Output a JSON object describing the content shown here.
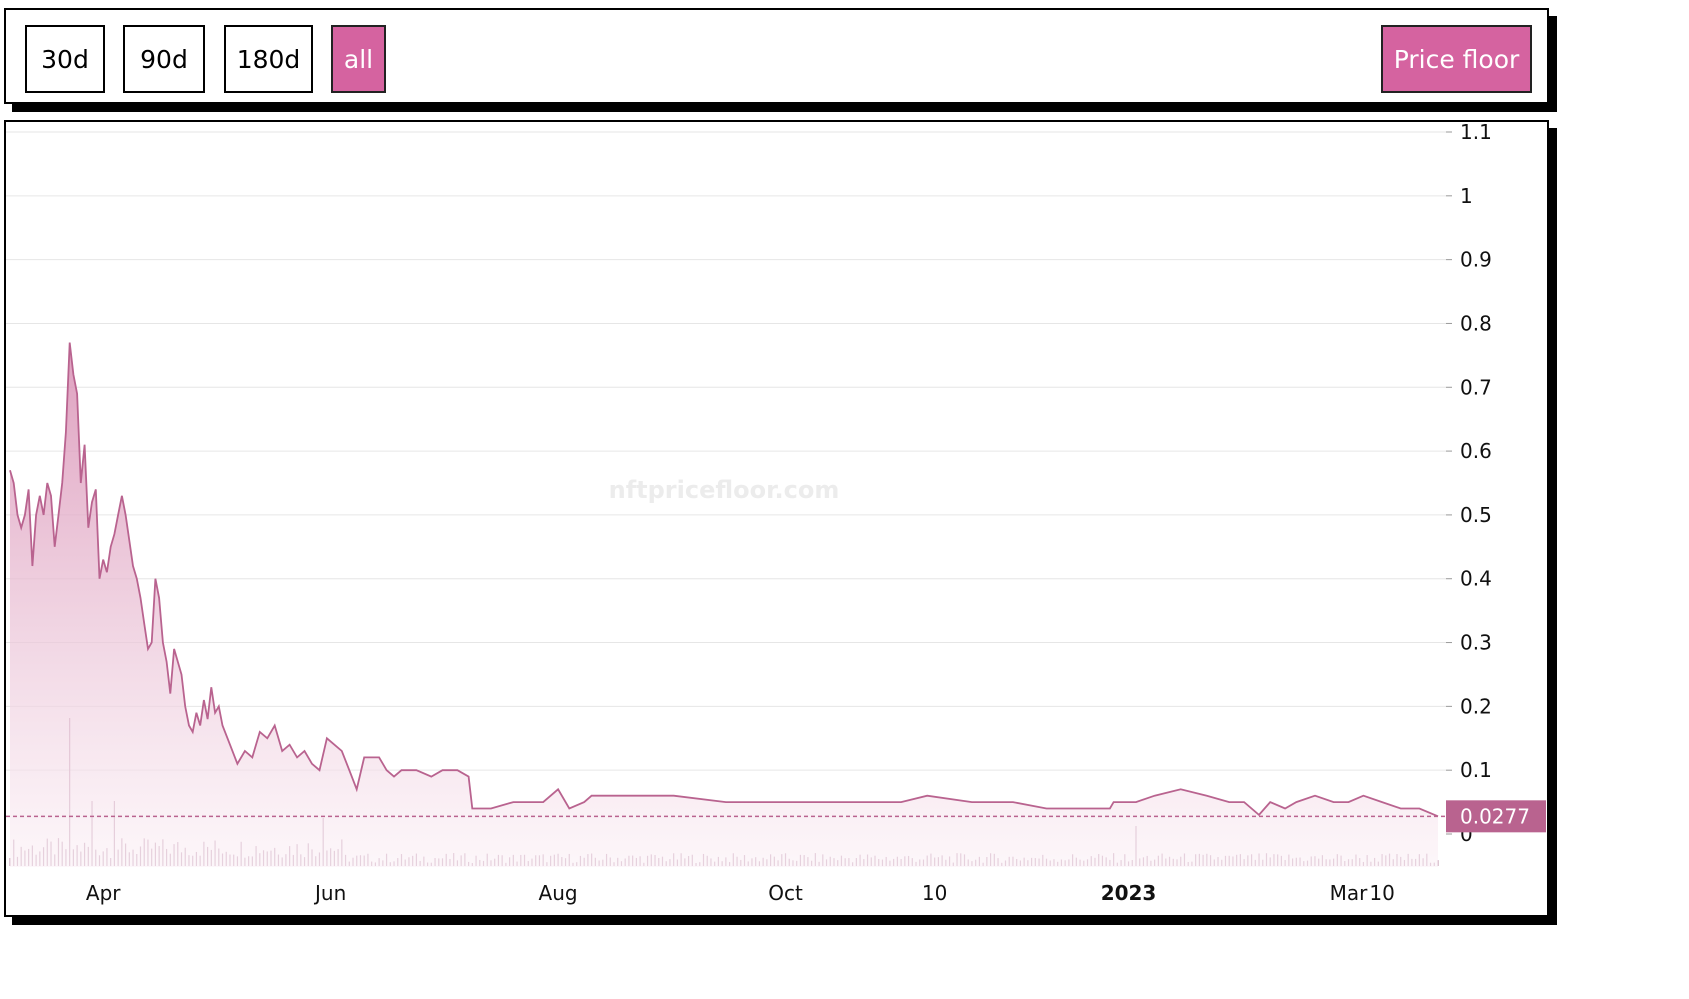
{
  "toolbar": {
    "range_buttons": [
      {
        "label": "30d",
        "active": false
      },
      {
        "label": "90d",
        "active": false
      },
      {
        "label": "180d",
        "active": false
      },
      {
        "label": "all",
        "active": true
      }
    ],
    "metric_button": {
      "label": "Price floor",
      "active": true
    }
  },
  "colors": {
    "accent": "#d563a0",
    "line": "#b9638f",
    "fill_top": "#d88eb3",
    "fill_bottom": "#fbf1f6",
    "volume": "#c7a2b8",
    "grid": "#e6e6e6"
  },
  "chart_data": {
    "type": "area",
    "title": "",
    "xlabel": "",
    "ylabel": "",
    "watermark": "nftpricefloor.com",
    "ylim": [
      0,
      1.1
    ],
    "yticks": [
      "0",
      "0.1",
      "0.2",
      "0.3",
      "0.4",
      "0.5",
      "0.6",
      "0.7",
      "0.8",
      "0.9",
      "1",
      "1.1"
    ],
    "xticks": [
      {
        "label": "Apr",
        "date": "2022-04-01",
        "bold": false
      },
      {
        "label": "Jun",
        "date": "2022-06-01",
        "bold": false
      },
      {
        "label": "Aug",
        "date": "2022-08-01",
        "bold": false
      },
      {
        "label": "Oct",
        "date": "2022-10-01",
        "bold": false
      },
      {
        "label": "10",
        "date": "2022-11-10",
        "bold": false
      },
      {
        "label": "2023",
        "date": "2023-01-01",
        "bold": true
      },
      {
        "label": "Mar",
        "date": "2023-03-01",
        "bold": false
      },
      {
        "label": "10",
        "date": "2023-03-10",
        "bold": false
      }
    ],
    "grid": true,
    "last_value": "0.0277",
    "series": [
      {
        "values": [
          [
            "2022-03-07",
            0.57
          ],
          [
            "2022-03-08",
            0.55
          ],
          [
            "2022-03-09",
            0.5
          ],
          [
            "2022-03-10",
            0.48
          ],
          [
            "2022-03-11",
            0.5
          ],
          [
            "2022-03-12",
            0.54
          ],
          [
            "2022-03-13",
            0.42
          ],
          [
            "2022-03-14",
            0.5
          ],
          [
            "2022-03-15",
            0.53
          ],
          [
            "2022-03-16",
            0.5
          ],
          [
            "2022-03-17",
            0.55
          ],
          [
            "2022-03-18",
            0.53
          ],
          [
            "2022-03-19",
            0.45
          ],
          [
            "2022-03-20",
            0.5
          ],
          [
            "2022-03-21",
            0.55
          ],
          [
            "2022-03-22",
            0.63
          ],
          [
            "2022-03-23",
            0.77
          ],
          [
            "2022-03-24",
            0.72
          ],
          [
            "2022-03-25",
            0.69
          ],
          [
            "2022-03-26",
            0.55
          ],
          [
            "2022-03-27",
            0.61
          ],
          [
            "2022-03-28",
            0.48
          ],
          [
            "2022-03-29",
            0.52
          ],
          [
            "2022-03-30",
            0.54
          ],
          [
            "2022-03-31",
            0.4
          ],
          [
            "2022-04-01",
            0.43
          ],
          [
            "2022-04-02",
            0.41
          ],
          [
            "2022-04-03",
            0.45
          ],
          [
            "2022-04-04",
            0.47
          ],
          [
            "2022-04-05",
            0.5
          ],
          [
            "2022-04-06",
            0.53
          ],
          [
            "2022-04-07",
            0.5
          ],
          [
            "2022-04-08",
            0.46
          ],
          [
            "2022-04-09",
            0.42
          ],
          [
            "2022-04-10",
            0.4
          ],
          [
            "2022-04-11",
            0.37
          ],
          [
            "2022-04-12",
            0.33
          ],
          [
            "2022-04-13",
            0.29
          ],
          [
            "2022-04-14",
            0.3
          ],
          [
            "2022-04-15",
            0.4
          ],
          [
            "2022-04-16",
            0.37
          ],
          [
            "2022-04-17",
            0.3
          ],
          [
            "2022-04-18",
            0.27
          ],
          [
            "2022-04-19",
            0.22
          ],
          [
            "2022-04-20",
            0.29
          ],
          [
            "2022-04-21",
            0.27
          ],
          [
            "2022-04-22",
            0.25
          ],
          [
            "2022-04-23",
            0.2
          ],
          [
            "2022-04-24",
            0.17
          ],
          [
            "2022-04-25",
            0.16
          ],
          [
            "2022-04-26",
            0.19
          ],
          [
            "2022-04-27",
            0.17
          ],
          [
            "2022-04-28",
            0.21
          ],
          [
            "2022-04-29",
            0.18
          ],
          [
            "2022-04-30",
            0.23
          ],
          [
            "2022-05-01",
            0.19
          ],
          [
            "2022-05-02",
            0.2
          ],
          [
            "2022-05-03",
            0.17
          ],
          [
            "2022-05-05",
            0.14
          ],
          [
            "2022-05-07",
            0.11
          ],
          [
            "2022-05-09",
            0.13
          ],
          [
            "2022-05-11",
            0.12
          ],
          [
            "2022-05-13",
            0.16
          ],
          [
            "2022-05-15",
            0.15
          ],
          [
            "2022-05-17",
            0.17
          ],
          [
            "2022-05-19",
            0.13
          ],
          [
            "2022-05-21",
            0.14
          ],
          [
            "2022-05-23",
            0.12
          ],
          [
            "2022-05-25",
            0.13
          ],
          [
            "2022-05-27",
            0.11
          ],
          [
            "2022-05-29",
            0.1
          ],
          [
            "2022-05-31",
            0.15
          ],
          [
            "2022-06-02",
            0.14
          ],
          [
            "2022-06-04",
            0.13
          ],
          [
            "2022-06-06",
            0.1
          ],
          [
            "2022-06-08",
            0.07
          ],
          [
            "2022-06-10",
            0.12
          ],
          [
            "2022-06-14",
            0.12
          ],
          [
            "2022-06-16",
            0.1
          ],
          [
            "2022-06-18",
            0.09
          ],
          [
            "2022-06-20",
            0.1
          ],
          [
            "2022-06-24",
            0.1
          ],
          [
            "2022-06-28",
            0.09
          ],
          [
            "2022-07-01",
            0.1
          ],
          [
            "2022-07-05",
            0.1
          ],
          [
            "2022-07-08",
            0.09
          ],
          [
            "2022-07-09",
            0.04
          ],
          [
            "2022-07-14",
            0.04
          ],
          [
            "2022-07-20",
            0.05
          ],
          [
            "2022-07-28",
            0.05
          ],
          [
            "2022-08-01",
            0.07
          ],
          [
            "2022-08-04",
            0.04
          ],
          [
            "2022-08-08",
            0.05
          ],
          [
            "2022-08-10",
            0.06
          ],
          [
            "2022-08-20",
            0.06
          ],
          [
            "2022-09-01",
            0.06
          ],
          [
            "2022-09-15",
            0.05
          ],
          [
            "2022-10-01",
            0.05
          ],
          [
            "2022-10-20",
            0.05
          ],
          [
            "2022-11-01",
            0.05
          ],
          [
            "2022-11-08",
            0.06
          ],
          [
            "2022-11-20",
            0.05
          ],
          [
            "2022-12-01",
            0.05
          ],
          [
            "2022-12-10",
            0.04
          ],
          [
            "2022-12-20",
            0.04
          ],
          [
            "2022-12-27",
            0.04
          ],
          [
            "2022-12-28",
            0.05
          ],
          [
            "2023-01-03",
            0.05
          ],
          [
            "2023-01-08",
            0.06
          ],
          [
            "2023-01-15",
            0.07
          ],
          [
            "2023-01-22",
            0.06
          ],
          [
            "2023-01-28",
            0.05
          ],
          [
            "2023-02-01",
            0.05
          ],
          [
            "2023-02-05",
            0.03
          ],
          [
            "2023-02-08",
            0.05
          ],
          [
            "2023-02-12",
            0.04
          ],
          [
            "2023-02-15",
            0.05
          ],
          [
            "2023-02-20",
            0.06
          ],
          [
            "2023-02-25",
            0.05
          ],
          [
            "2023-03-01",
            0.05
          ],
          [
            "2023-03-05",
            0.06
          ],
          [
            "2023-03-10",
            0.05
          ],
          [
            "2023-03-15",
            0.04
          ],
          [
            "2023-03-20",
            0.04
          ],
          [
            "2023-03-25",
            0.0277
          ]
        ]
      }
    ]
  }
}
